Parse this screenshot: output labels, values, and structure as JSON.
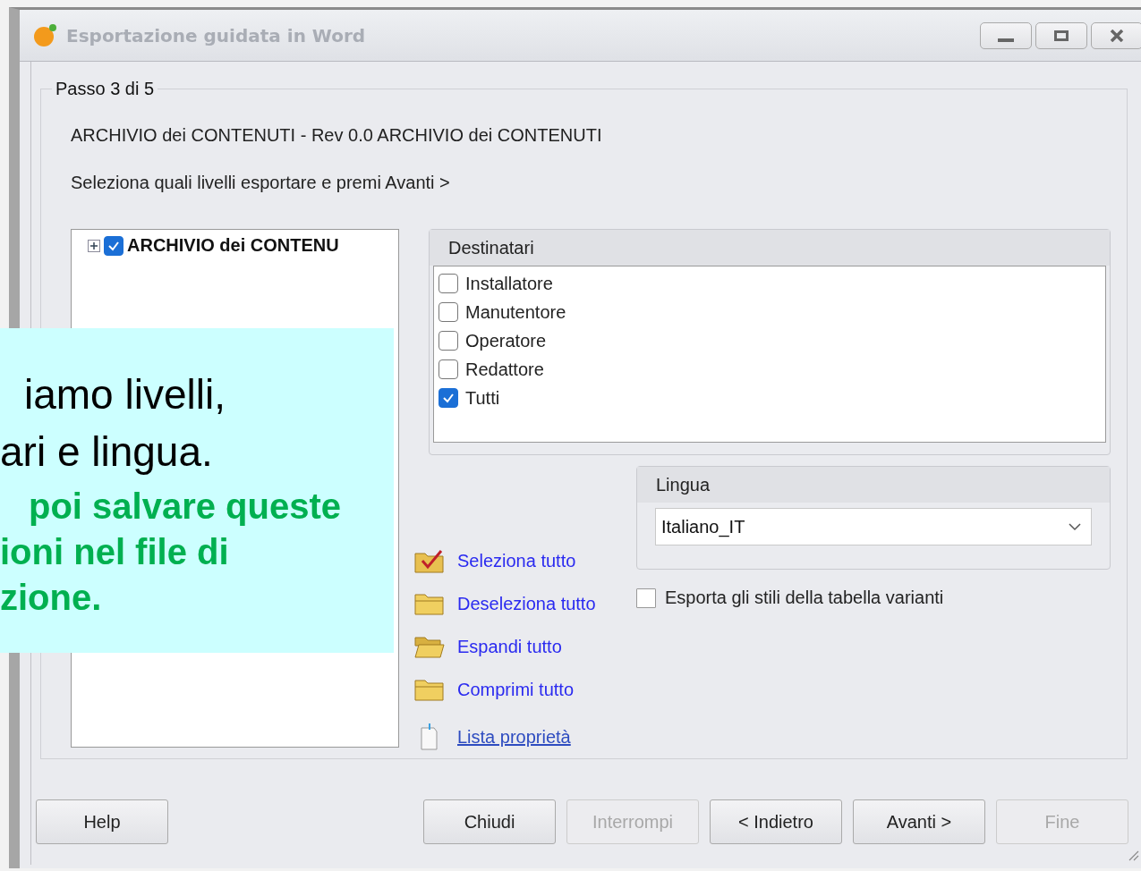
{
  "window": {
    "title": "Esportazione guidata in Word"
  },
  "step": {
    "legend": "Passo 3 di 5",
    "heading": "ARCHIVIO dei CONTENUTI - Rev 0.0 ARCHIVIO dei CONTENUTI",
    "instruction": "Seleziona quali livelli esportare e premi Avanti >"
  },
  "tree": {
    "items": [
      {
        "label": "ARCHIVIO dei CONTENU",
        "checked": true,
        "expanded": false
      }
    ]
  },
  "recipients": {
    "title": "Destinatari",
    "items": [
      {
        "label": "Installatore",
        "checked": false
      },
      {
        "label": "Manutentore",
        "checked": false
      },
      {
        "label": "Operatore",
        "checked": false
      },
      {
        "label": "Redattore",
        "checked": false
      },
      {
        "label": "Tutti",
        "checked": true
      }
    ]
  },
  "language": {
    "title": "Lingua",
    "value": "Italiano_IT"
  },
  "export_styles": {
    "label": "Esporta gli stili della tabella varianti",
    "checked": false
  },
  "actions": [
    {
      "label": "Seleziona tutto",
      "kind": "check"
    },
    {
      "label": "Deseleziona tutto",
      "kind": "folder"
    },
    {
      "label": "Espandi tutto",
      "kind": "open"
    },
    {
      "label": "Comprimi tutto",
      "kind": "folder"
    },
    {
      "label": "Lista proprietà",
      "kind": "link"
    }
  ],
  "buttons": [
    {
      "label": "Help",
      "disabled": false
    },
    {
      "label": "Chiudi",
      "disabled": false
    },
    {
      "label": "Interrompi",
      "disabled": true
    },
    {
      "label": "< Indietro",
      "disabled": false
    },
    {
      "label": "Avanti >",
      "disabled": false
    },
    {
      "label": "Fine",
      "disabled": true
    }
  ],
  "callout": {
    "lines": [
      {
        "text": "iamo livelli,",
        "kind": "main"
      },
      {
        "text": "ari e lingua.",
        "kind": "main"
      },
      {
        "text": "poi salvare queste",
        "kind": "note"
      },
      {
        "text": "ioni nel file di",
        "kind": "note"
      },
      {
        "text": "zione.",
        "kind": "note"
      }
    ]
  }
}
